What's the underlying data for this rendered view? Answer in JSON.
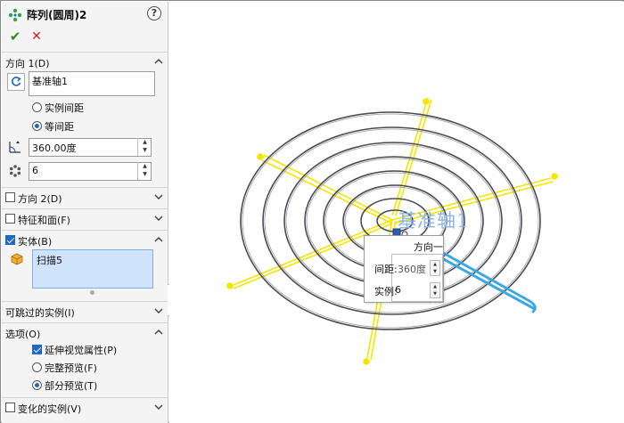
{
  "panel": {
    "title": "阵列(圆周)2",
    "help": "?",
    "ok": "✔",
    "cancel": "✕",
    "direction1": {
      "label": "方向 1(D)",
      "axis_value": "基准轴1",
      "option_spacing": "实例间距",
      "option_equal": "等间距",
      "angle_value": "360.00度",
      "count_value": "6"
    },
    "direction2": {
      "label": "方向 2(D)"
    },
    "features_faces": {
      "label": "特征和面(F)"
    },
    "bodies": {
      "label": "实体(B)",
      "item": "扫描5"
    },
    "skip_instances": {
      "label": "可跳过的实例(I)"
    },
    "options": {
      "label": "选项(O)",
      "propagate": "延伸视觉属性(P)",
      "full_preview": "完整预览(F)",
      "partial_preview": "部分预览(T)"
    },
    "varied_instances": {
      "label": "变化的实例(V)"
    }
  },
  "viewport": {
    "axis_label": "基准轴1",
    "callout": {
      "title": "方向一",
      "spacing_label": "间距:",
      "spacing_value": "360度",
      "instances_label": "实例:",
      "instances_value": "6"
    }
  },
  "colors": {
    "accent": "#1e66c8",
    "selection": "#cfe4fb",
    "preview_yellow": "#f5e500",
    "highlight_blue": "#3aa8e6",
    "coil": "#4a4a55"
  }
}
